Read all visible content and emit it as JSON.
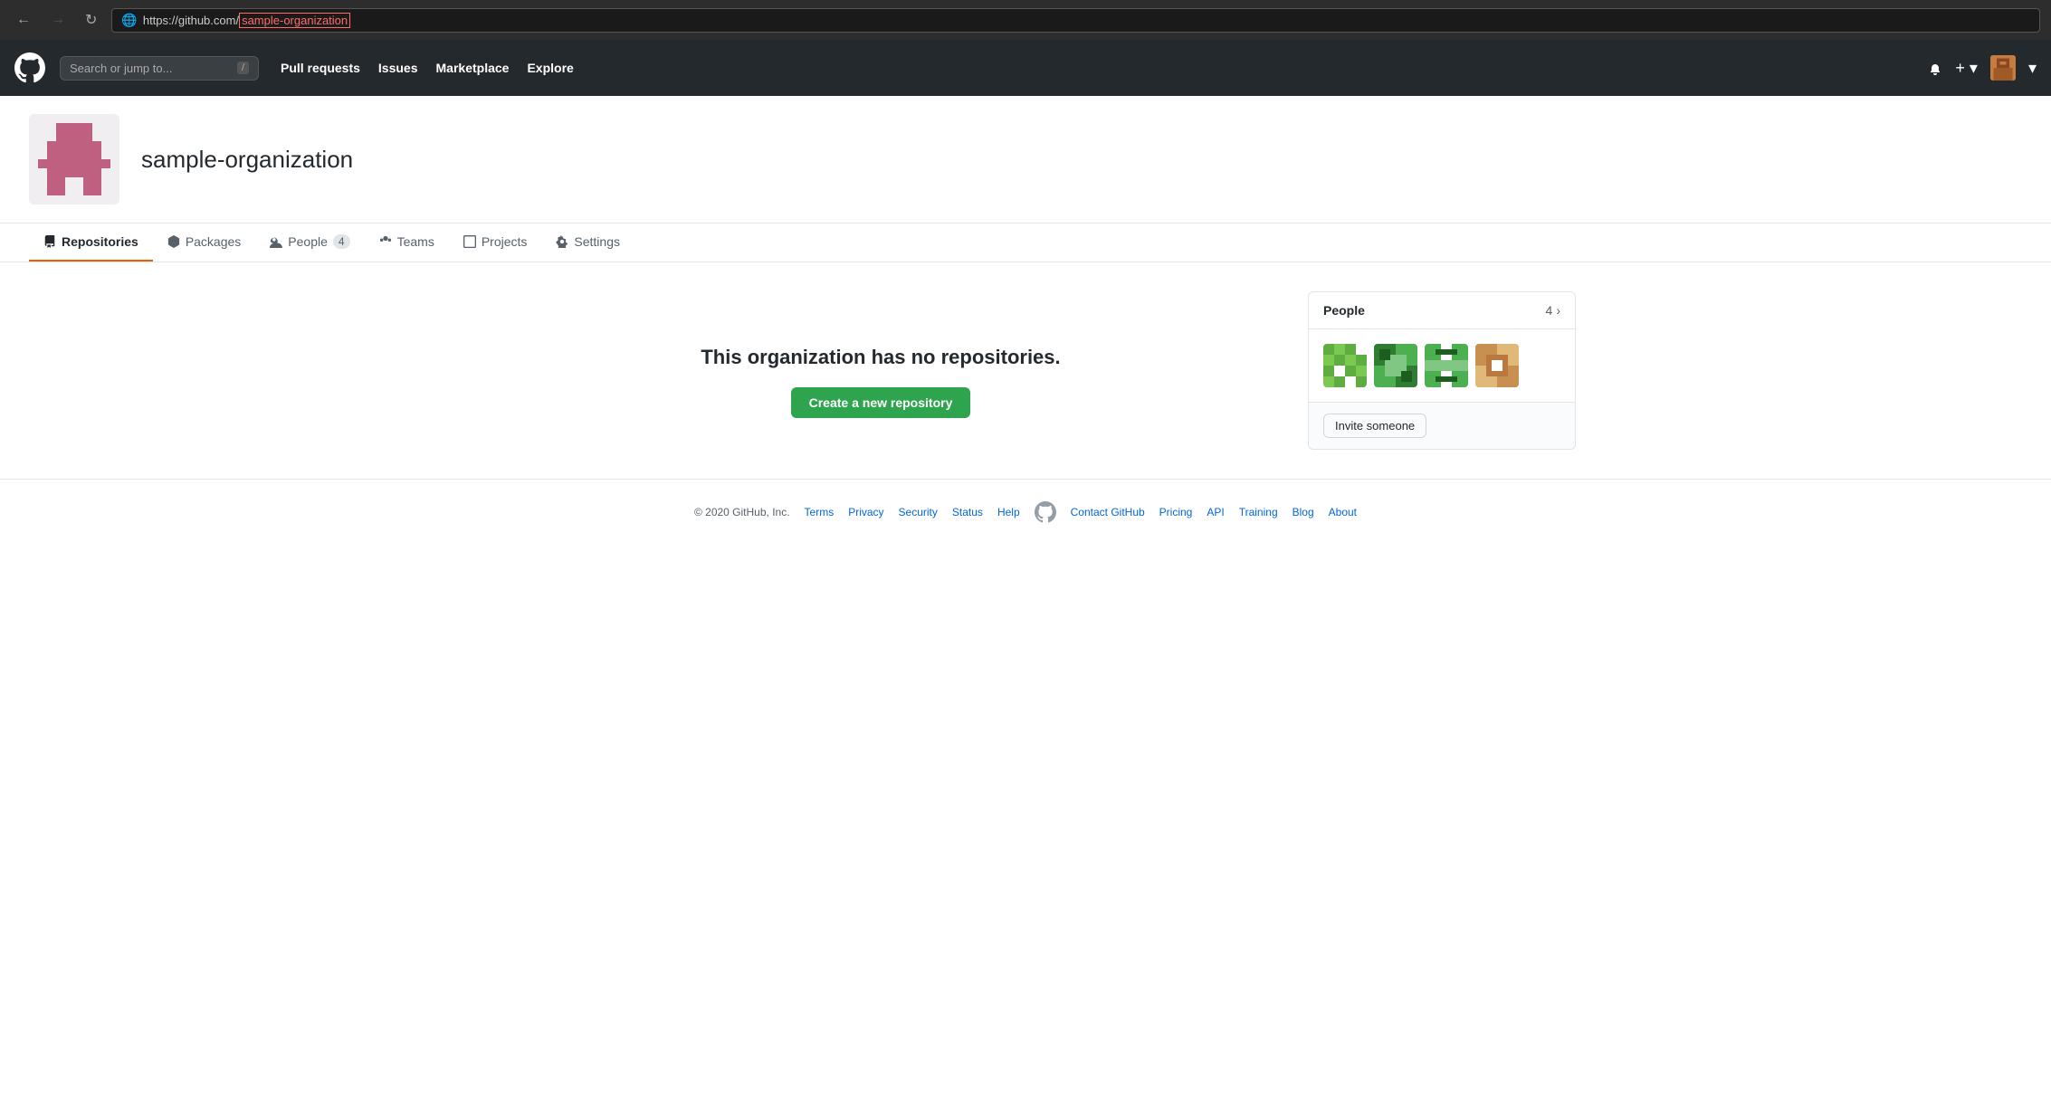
{
  "browser": {
    "back_label": "←",
    "forward_label": "→",
    "reload_label": "↻",
    "url_prefix": "https://github.com/",
    "url_highlight": "sample-organization"
  },
  "nav": {
    "search_placeholder": "Search or jump to...",
    "search_shortcut": "/",
    "pull_requests": "Pull requests",
    "issues": "Issues",
    "marketplace": "Marketplace",
    "explore": "Explore"
  },
  "org": {
    "name": "sample-organization"
  },
  "tabs": [
    {
      "id": "repositories",
      "label": "Repositories",
      "badge": null,
      "active": true
    },
    {
      "id": "packages",
      "label": "Packages",
      "badge": null,
      "active": false
    },
    {
      "id": "people",
      "label": "People",
      "badge": "4",
      "active": false
    },
    {
      "id": "teams",
      "label": "Teams",
      "badge": null,
      "active": false
    },
    {
      "id": "projects",
      "label": "Projects",
      "badge": null,
      "active": false
    },
    {
      "id": "settings",
      "label": "Settings",
      "badge": null,
      "active": false
    }
  ],
  "main": {
    "empty_message": "This organization has no repositories.",
    "create_repo_label": "Create a new repository"
  },
  "people_card": {
    "title": "People",
    "count": "4",
    "chevron": "›",
    "invite_label": "Invite someone"
  },
  "footer": {
    "copyright": "© 2020 GitHub, Inc.",
    "links": [
      {
        "label": "Terms"
      },
      {
        "label": "Privacy"
      },
      {
        "label": "Security"
      },
      {
        "label": "Status"
      },
      {
        "label": "Help"
      },
      {
        "label": "Contact GitHub"
      },
      {
        "label": "Pricing"
      },
      {
        "label": "API"
      },
      {
        "label": "Training"
      },
      {
        "label": "Blog"
      },
      {
        "label": "About"
      }
    ]
  }
}
